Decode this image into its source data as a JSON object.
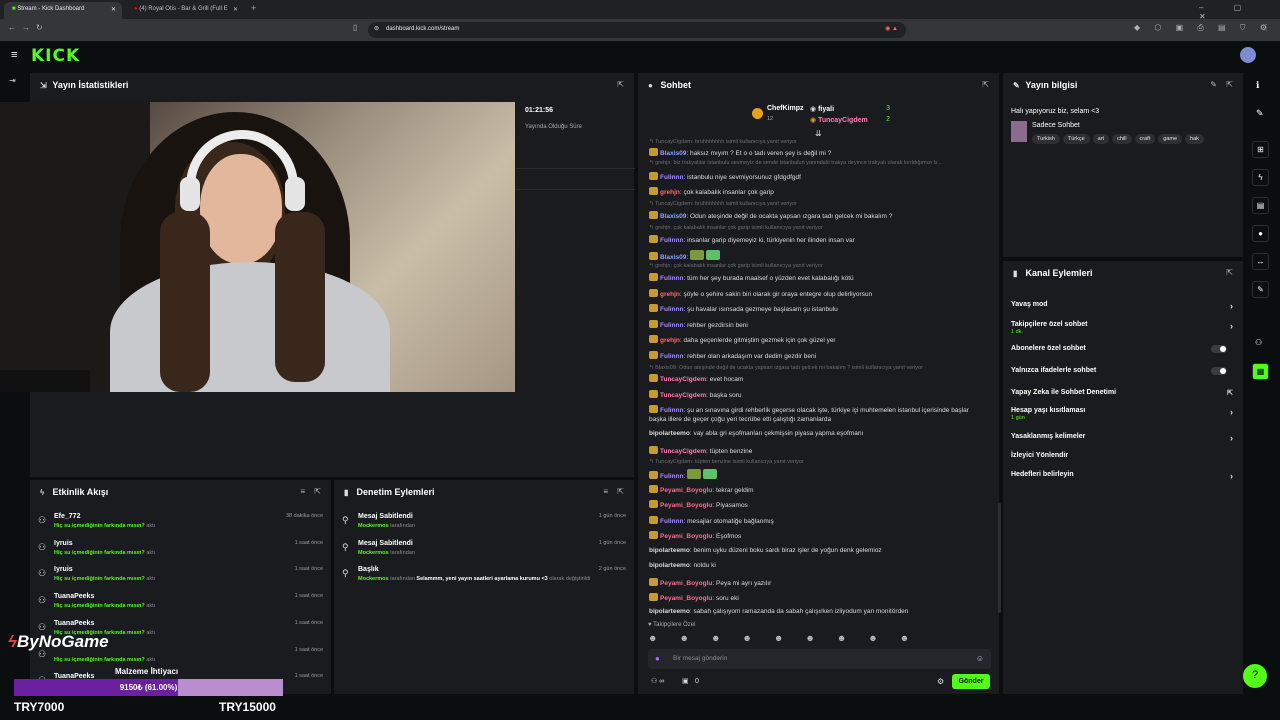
{
  "browser": {
    "tabs": [
      {
        "label": "Stream - Kick Dashboard"
      },
      {
        "label": "(4) Royal Otis - Bar & Grill (Full E"
      }
    ],
    "url": "dashboard.kick.com/stream"
  },
  "header": {
    "logo": "KICK"
  },
  "stats": {
    "title": "Yayın İstatistikleri",
    "uptime": "01:21:56",
    "uptime_label": "Yayında Olduğu Süre"
  },
  "chat": {
    "title": "Sohbet",
    "top": [
      {
        "name": "ChefKimpz",
        "count": "12"
      },
      {
        "name": "fiyali",
        "value": "3"
      },
      {
        "name": "TuncayCigdem",
        "value": "2"
      }
    ],
    "messages": [
      {
        "reply": "TuncayCigdem: bruhhhhhhh isimli kullanıcıya yanıt veriyor"
      },
      {
        "user": "Blaxis09",
        "color": "#8aa4ff",
        "text": "haksız mıyım ? Et o o tadı veren şey is değil mi ?"
      },
      {
        "reply": "grehjn: biz trakyalılar istanbulu sevmeyiz de sende istanbulun yanındaki trakya deyince trakyalı olarak kırıldığımızı b..."
      },
      {
        "user": "Fulinnn",
        "color": "#a68cff",
        "text": "istanbulu niye sevmiyorsunuz gfdgdfgdf"
      },
      {
        "user": "grehjn",
        "color": "#ff6b6b",
        "text": "çok kalabalık insanlar çok garip"
      },
      {
        "reply": "TuncayCigdem: bruhhhhhhh isimli kullanıcıya yanıt veriyor"
      },
      {
        "user": "Blaxis09",
        "color": "#8aa4ff",
        "text": "Odun ateşinde değil de ocakta yapsan ızgara tadı gelcek mi bakalım ?"
      },
      {
        "reply": "grehjn: çok kalabalık insanlar çok garip isimli kullanıcıya yanıt veriyor"
      },
      {
        "user": "Fulinnn",
        "color": "#a68cff",
        "text": "insanlar garip diyemeyiz ki, türkiyenin her ilinden insan var"
      },
      {
        "user": "Blaxis09",
        "color": "#8aa4ff",
        "text": ""
      },
      {
        "reply": "grehjn: çok kalabalık insanlar çok garip isimli kullanıcıya yanıt veriyor"
      },
      {
        "user": "Fulinnn",
        "color": "#a68cff",
        "text": "tüm her şey burada maalsef o yüzden evet kalabalığı kötü"
      },
      {
        "user": "grehjn",
        "color": "#ff6b6b",
        "text": "şöyle o şehire sakin biri olarak gir oraya entegre olup delirliyorsun"
      },
      {
        "user": "Fulinnn",
        "color": "#a68cff",
        "text": "şu havalar ısınsada gezmeye başlasam şu istanbulu"
      },
      {
        "user": "Fulinnn",
        "color": "#a68cff",
        "text": "rehber gezdirsin beni"
      },
      {
        "user": "grehjn",
        "color": "#ff6b6b",
        "text": "daha geçenlerde gitmiştim gezmek için çok güzel yer"
      },
      {
        "user": "Fulinnn",
        "color": "#a68cff",
        "text": "rehber olan arkadaşım var dedim gezdir beni"
      },
      {
        "reply": "Blaxis09: Odun ateşinde değil de ocakta yapsan ızgara tadı gelcek mi bakalım ? isimli kullanıcıya yanıt veriyor"
      },
      {
        "user": "TuncayCigdem",
        "color": "#ff7ab6",
        "text": "evet hocam"
      },
      {
        "user": "TuncayCigdem",
        "color": "#ff7ab6",
        "text": "başka soru"
      },
      {
        "user": "Fulinnn",
        "color": "#a68cff",
        "text": "şu an sınavına girdi rehberlik geçerse olacak işte, türkiye içi muhtemelen istanbul içerisinde başlar"
      },
      {
        "cont": "başka illere de geçer çoğu yeri tecrübe etti çalıştığı zamanlarda"
      },
      {
        "user": "bipolarteemo",
        "color": "#d9d9d9",
        "text": "vay abla gri eşofmanları çekmişsin piyasa yapma eşofmanı"
      },
      {
        "user": "TuncayCigdem",
        "color": "#ff7ab6",
        "text": "tüpten benzine"
      },
      {
        "reply": "TuncayCigdem: tüpten benzine isimli kullanıcıya yanıt veriyor"
      },
      {
        "user": "Fulinnn",
        "color": "#a68cff",
        "text": ""
      },
      {
        "user": "Peyami_Boyoglu",
        "color": "#ff6b8b",
        "text": "tekrar geldim"
      },
      {
        "user": "Peyami_Boyoglu",
        "color": "#ff6b8b",
        "text": "Piyasamos"
      },
      {
        "user": "Fulinnn",
        "color": "#a68cff",
        "text": "mesajlar otomatiğe bağlanmış"
      },
      {
        "user": "Peyami_Boyoglu",
        "color": "#ff6b8b",
        "text": "Eşofmos"
      },
      {
        "user": "bipolarteemo",
        "color": "#d9d9d9",
        "text": "benim uyku düzeni boku sardı biraz işler de yoğun denk gelemioz"
      },
      {
        "user": "bipolarteemo",
        "color": "#d9d9d9",
        "text": "noldu ki"
      },
      {
        "user": "Peyami_Boyoglu",
        "color": "#ff6b8b",
        "text": "Peya mi ayrı yazılır"
      },
      {
        "user": "Peyami_Boyoglu",
        "color": "#ff6b8b",
        "text": "soru eki"
      },
      {
        "user": "bipolarteemo",
        "color": "#d9d9d9",
        "text": "sabah çalışıyom ramazanda da sabah çalışırken izliyodum yan monitörden"
      }
    ],
    "followers_only": "Takipçilere Özel",
    "placeholder": "Bir mesaj gönderin",
    "viewers": "0",
    "send": "Gönder"
  },
  "events": {
    "title": "Etkinlik Akışı",
    "items": [
      {
        "name": "Efe_772",
        "sub_prefix": "Hiç su içmediğinin farkında mısın?",
        "sub_suffix": "aktı",
        "time": "38 dakika önce"
      },
      {
        "name": "Iyruis",
        "sub_prefix": "Hiç su içmediğinin farkında mısın?",
        "sub_suffix": "aktı",
        "time": "1 saat önce"
      },
      {
        "name": "Iyruis",
        "sub_prefix": "Hiç su içmediğinin farkında mısın?",
        "sub_suffix": "aktı",
        "time": "1 saat önce"
      },
      {
        "name": "TuanaPeeks",
        "sub_prefix": "Hiç su içmediğinin farkında mısın?",
        "sub_suffix": "aktı",
        "time": "1 saat önce"
      },
      {
        "name": "TuanaPeeks",
        "sub_prefix": "Hiç su içmediğinin farkında mısın?",
        "sub_suffix": "aktı",
        "time": "1 saat önce"
      },
      {
        "name": "",
        "sub_prefix": "Hiç su içmediğinin farkında mısın?",
        "sub_suffix": "aktı",
        "time": "1 saat önce"
      },
      {
        "name": "TuanaPeeks",
        "sub_prefix": "",
        "sub_suffix": "",
        "time": "1 saat önce"
      }
    ]
  },
  "moderation": {
    "title": "Denetim Eylemleri",
    "items": [
      {
        "name": "Mesaj Sabitlendi",
        "by": "Mockermos",
        "suffix": "tarafından",
        "text": "",
        "time": "1 gün önce"
      },
      {
        "name": "Mesaj Sabitlendi",
        "by": "Mockermos",
        "suffix": "tarafından",
        "text": "",
        "time": "1 gün önce"
      },
      {
        "name": "Başlık",
        "by": "Mockermos",
        "suffix": "tarafından",
        "text": "Selammm, yeni yayın saatleri ayarlama kurumu <3",
        "suffix2": "olarak değiştirildi",
        "time": "2 gün önce"
      }
    ]
  },
  "info": {
    "title": "Yayın bilgisi",
    "stream_title": "Halı yapıyoruz biz, selam <3",
    "chat_mode": "Sadece Sohbet",
    "tags": [
      "Turkish",
      "Türkçe",
      "art",
      "chill",
      "craft",
      "game",
      "hak"
    ]
  },
  "actions": {
    "title": "Kanal Eylemleri",
    "items": [
      {
        "label": "Yavaş mod",
        "kind": "chev"
      },
      {
        "label": "Takipçilere özel sohbet",
        "sub": "1 dk.",
        "kind": "chev"
      },
      {
        "label": "Abonelere özel sohbet",
        "kind": "toggle"
      },
      {
        "label": "Yalnızca ifadelerle sohbet",
        "kind": "toggle"
      },
      {
        "label": "Yapay Zeka ile Sohbet Denetimi",
        "kind": "ext"
      },
      {
        "label": "Hesap yaşı kısıtlaması",
        "sub": "1 gün",
        "kind": "chev"
      },
      {
        "label": "Yasaklanmış kelimeler",
        "kind": "chev"
      },
      {
        "label": "İzleyici Yönlendir",
        "kind": "none"
      },
      {
        "label": "Hedefleri belirleyin",
        "kind": "chev"
      }
    ]
  },
  "overlay": {
    "brand": "ByNoGame",
    "goal_title": "Malzeme İhtiyacı",
    "progress_text": "9150₺ (61.00%)",
    "progress": 0.61,
    "left": "TRY7000",
    "right": "TRY15000"
  }
}
